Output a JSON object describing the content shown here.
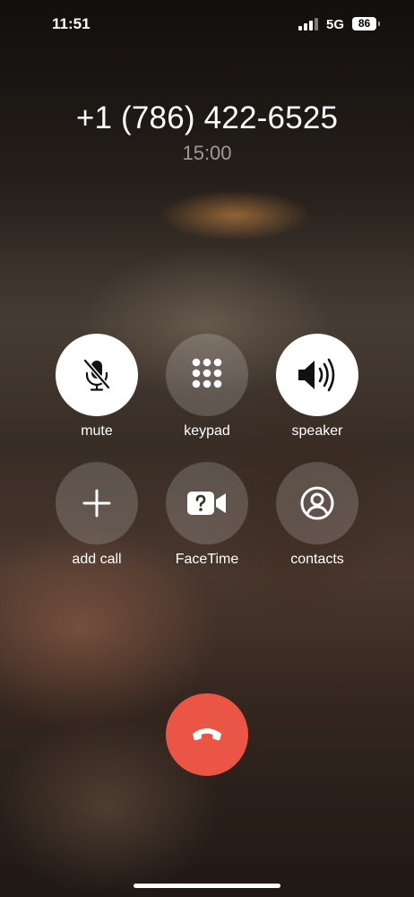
{
  "status_bar": {
    "time": "11:51",
    "network": "5G",
    "battery": "86"
  },
  "call": {
    "number": "+1 (786) 422-6525",
    "duration": "15:00"
  },
  "controls": [
    {
      "label": "mute",
      "icon": "mic-slash-icon",
      "active": true
    },
    {
      "label": "keypad",
      "icon": "keypad-icon",
      "active": false
    },
    {
      "label": "speaker",
      "icon": "speaker-wave-icon",
      "active": true
    },
    {
      "label": "add call",
      "icon": "plus-icon",
      "active": false
    },
    {
      "label": "FaceTime",
      "icon": "facetime-question-icon",
      "active": false
    },
    {
      "label": "contacts",
      "icon": "person-circle-icon",
      "active": false
    }
  ],
  "end_call": {
    "icon": "phone-down-icon"
  },
  "colors": {
    "end_call": "#eb5545",
    "active_button": "#ffffff",
    "inactive_button": "rgba(255,255,255,0.18)"
  }
}
